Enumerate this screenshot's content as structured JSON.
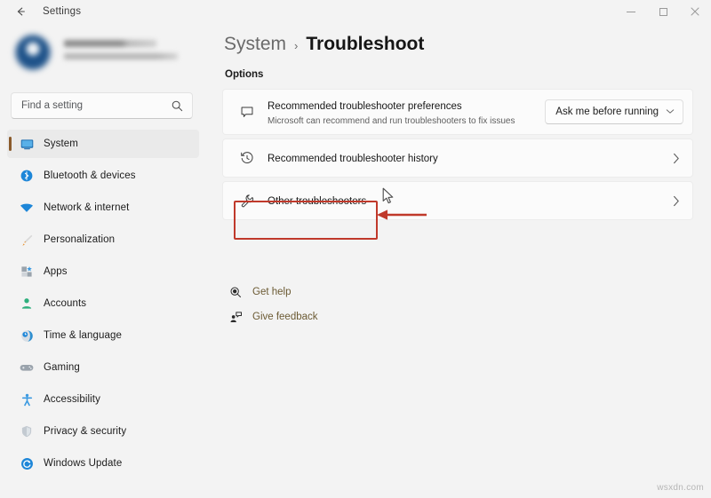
{
  "titlebar": {
    "back_icon": "back-arrow-icon",
    "title": "Settings",
    "minimize_label": "Minimize",
    "maximize_label": "Maximize",
    "close_label": "Close"
  },
  "sidebar": {
    "profile": {
      "name": "",
      "email": "",
      "avatar_icon": "avatar"
    },
    "search": {
      "placeholder": "Find a setting",
      "value": "",
      "icon": "search-icon"
    },
    "items": [
      {
        "label": "System",
        "icon": "monitor-icon",
        "selected": true
      },
      {
        "label": "Bluetooth & devices",
        "icon": "bluetooth-icon",
        "selected": false
      },
      {
        "label": "Network & internet",
        "icon": "wifi-icon",
        "selected": false
      },
      {
        "label": "Personalization",
        "icon": "paintbrush-icon",
        "selected": false
      },
      {
        "label": "Apps",
        "icon": "apps-icon",
        "selected": false
      },
      {
        "label": "Accounts",
        "icon": "person-icon",
        "selected": false
      },
      {
        "label": "Time & language",
        "icon": "globe-clock-icon",
        "selected": false
      },
      {
        "label": "Gaming",
        "icon": "gamepad-icon",
        "selected": false
      },
      {
        "label": "Accessibility",
        "icon": "accessibility-icon",
        "selected": false
      },
      {
        "label": "Privacy & security",
        "icon": "shield-icon",
        "selected": false
      },
      {
        "label": "Windows Update",
        "icon": "update-icon",
        "selected": false
      }
    ]
  },
  "main": {
    "breadcrumb": {
      "root": "System",
      "separator": "›",
      "leaf": "Troubleshoot"
    },
    "section_label": "Options",
    "cards": [
      {
        "title": "Recommended troubleshooter preferences",
        "subtitle": "Microsoft can recommend and run troubleshooters to fix issues",
        "icon": "speech-bubble-icon",
        "control": "dropdown",
        "dropdown_value": "Ask me before running"
      },
      {
        "title": "Recommended troubleshooter history",
        "subtitle": "",
        "icon": "history-clock-icon",
        "control": "chevron",
        "dropdown_value": ""
      },
      {
        "title": "Other troubleshooters",
        "subtitle": "",
        "icon": "wrench-icon",
        "control": "chevron",
        "dropdown_value": ""
      }
    ],
    "links": [
      {
        "label": "Get help",
        "icon": "get-help-icon"
      },
      {
        "label": "Give feedback",
        "icon": "give-feedback-icon"
      }
    ]
  },
  "annotations": {
    "highlight_color": "#c0392b",
    "arrow_color": "#c0392b",
    "target": "Other troubleshooters"
  },
  "watermark": {
    "text": "wsxdn.com"
  }
}
